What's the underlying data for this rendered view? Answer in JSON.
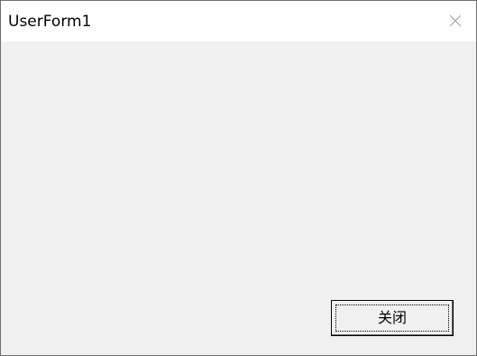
{
  "window": {
    "title": "UserForm1",
    "close_icon": "close-icon"
  },
  "form": {
    "close_button_label": "关闭"
  },
  "colors": {
    "titlebar_bg": "#ffffff",
    "client_bg": "#f0f0f0",
    "close_glyph": "#9e9e9e"
  }
}
